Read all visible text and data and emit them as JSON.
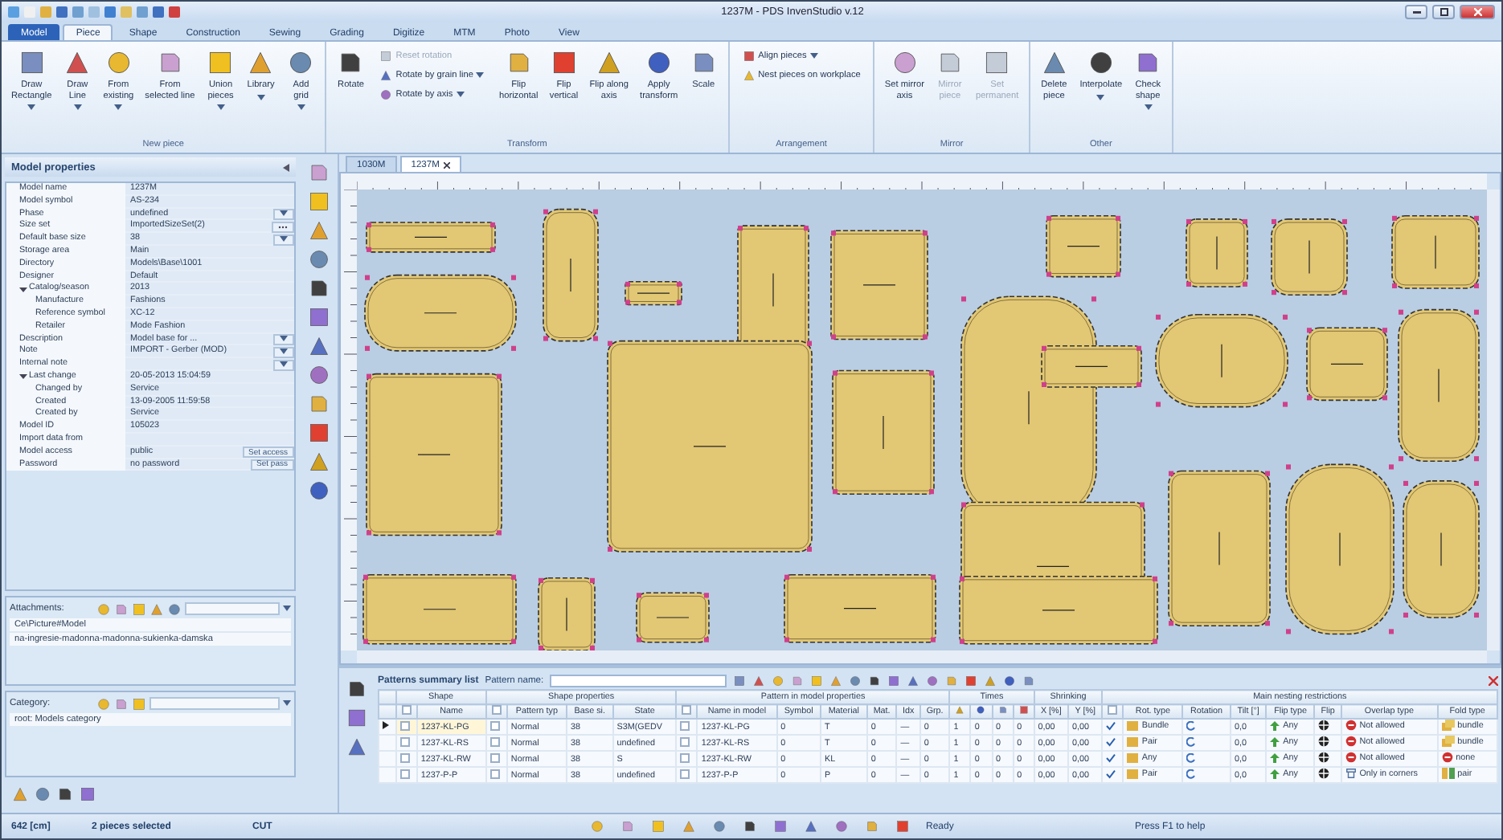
{
  "window": {
    "title": "1237M - PDS InvenStudio v.12"
  },
  "ribbon_tabs": [
    {
      "label": "Model",
      "kind": "app",
      "selected": false
    },
    {
      "label": "Piece",
      "kind": "tab",
      "selected": true
    },
    {
      "label": "Shape",
      "kind": "tab",
      "selected": false
    },
    {
      "label": "Construction",
      "kind": "tab",
      "selected": false
    },
    {
      "label": "Sewing",
      "kind": "tab",
      "selected": false
    },
    {
      "label": "Grading",
      "kind": "tab",
      "selected": false
    },
    {
      "label": "Digitize",
      "kind": "tab",
      "selected": false
    },
    {
      "label": "MTM",
      "kind": "tab",
      "selected": false
    },
    {
      "label": "Photo",
      "kind": "tab",
      "selected": false
    },
    {
      "label": "View",
      "kind": "tab",
      "selected": false
    }
  ],
  "ribbon_groups": [
    {
      "label": "New piece",
      "items": [
        {
          "kind": "large",
          "lines": [
            "Draw",
            "Rectangle"
          ],
          "dropdown": true,
          "disabled": false
        },
        {
          "kind": "large",
          "lines": [
            "Draw",
            "Line"
          ],
          "dropdown": true,
          "disabled": false
        },
        {
          "kind": "large",
          "lines": [
            "From",
            "existing"
          ],
          "dropdown": true,
          "disabled": false
        },
        {
          "kind": "large",
          "lines": [
            "From",
            "selected line"
          ],
          "dropdown": false,
          "disabled": false
        },
        {
          "kind": "large",
          "lines": [
            "Union",
            "pieces"
          ],
          "dropdown": true,
          "disabled": false
        },
        {
          "kind": "large",
          "lines": [
            "Library"
          ],
          "dropdown": true,
          "disabled": false
        },
        {
          "kind": "large",
          "lines": [
            "Add",
            "grid"
          ],
          "dropdown": true,
          "disabled": false
        }
      ]
    },
    {
      "label": "Transform",
      "items": [
        {
          "kind": "large",
          "lines": [
            "Rotate"
          ],
          "dropdown": false,
          "disabled": false
        },
        {
          "kind": "stack",
          "items": [
            {
              "label": "Reset rotation",
              "dropdown": false,
              "disabled": true
            },
            {
              "label": "Rotate by grain line",
              "dropdown": true,
              "disabled": false
            },
            {
              "label": "Rotate by axis",
              "dropdown": true,
              "disabled": false
            }
          ]
        },
        {
          "kind": "large",
          "lines": [
            "Flip",
            "horizontal"
          ],
          "dropdown": false,
          "disabled": false
        },
        {
          "kind": "large",
          "lines": [
            "Flip",
            "vertical"
          ],
          "dropdown": false,
          "disabled": false
        },
        {
          "kind": "large",
          "lines": [
            "Flip along",
            "axis"
          ],
          "dropdown": false,
          "disabled": false
        },
        {
          "kind": "large",
          "lines": [
            "Apply",
            "transform"
          ],
          "dropdown": false,
          "disabled": false
        },
        {
          "kind": "large",
          "lines": [
            "Scale"
          ],
          "dropdown": false,
          "disabled": false
        }
      ]
    },
    {
      "label": "Arrangement",
      "items": [
        {
          "kind": "stack",
          "items": [
            {
              "label": "Align pieces",
              "dropdown": true,
              "disabled": false
            },
            {
              "label": "Nest pieces on workplace",
              "dropdown": false,
              "disabled": false
            }
          ]
        }
      ]
    },
    {
      "label": "Mirror",
      "items": [
        {
          "kind": "large",
          "lines": [
            "Set mirror",
            "axis"
          ],
          "dropdown": false,
          "disabled": false
        },
        {
          "kind": "large",
          "lines": [
            "Mirror",
            "piece"
          ],
          "dropdown": false,
          "disabled": true
        },
        {
          "kind": "large",
          "lines": [
            "Set",
            "permanent"
          ],
          "dropdown": false,
          "disabled": true
        }
      ]
    },
    {
      "label": "Other",
      "items": [
        {
          "kind": "large",
          "lines": [
            "Delete",
            "piece"
          ],
          "dropdown": false,
          "disabled": false
        },
        {
          "kind": "large",
          "lines": [
            "Interpolate"
          ],
          "dropdown": true,
          "disabled": false
        },
        {
          "kind": "large",
          "lines": [
            "Check",
            "shape"
          ],
          "dropdown": true,
          "disabled": false
        }
      ]
    }
  ],
  "model_properties": {
    "title": "Model properties",
    "rows": [
      {
        "name": "Model name",
        "value": "1237M"
      },
      {
        "name": "Model symbol",
        "value": "AS-234"
      },
      {
        "kind": "dropdown",
        "name": "Phase",
        "value": "undefined"
      },
      {
        "kind": "ellipsis",
        "name": "Size set",
        "value": "ImportedSizeSet(2)"
      },
      {
        "kind": "dropdown",
        "name": "Default base size",
        "value": "38"
      },
      {
        "name": "Storage area",
        "value": "Main"
      },
      {
        "name": "Directory",
        "value": "Models\\Base\\1001"
      },
      {
        "name": "Designer",
        "value": "Default"
      },
      {
        "name": "Catalog/season",
        "value": "2013",
        "expanded": true,
        "children": [
          {
            "name": "Manufacture",
            "value": "Fashions"
          },
          {
            "name": "Reference symbol",
            "value": "XC-12"
          },
          {
            "name": "Retailer",
            "value": "Mode Fashion"
          }
        ]
      },
      {
        "kind": "dropdown",
        "name": "Description",
        "value": "Model base for ..."
      },
      {
        "kind": "dropdown",
        "name": "Note",
        "value": "IMPORT - Gerber (MOD)"
      },
      {
        "kind": "dropdown",
        "name": "Internal note"
      },
      {
        "name": "Last change",
        "value": "20-05-2013 15:04:59",
        "expanded": true,
        "children": [
          {
            "name": "Changed by",
            "value": "Service"
          },
          {
            "name": "Created",
            "value": "13-09-2005 11:59:58"
          },
          {
            "name": "Created by",
            "value": "Service"
          }
        ]
      },
      {
        "name": "Model ID",
        "value": "105023"
      },
      {
        "name": "Import data from"
      },
      {
        "kind": "button",
        "name": "Model access",
        "value": "public",
        "button": "Set access"
      },
      {
        "kind": "button",
        "name": "Password",
        "value": "no password",
        "button": "Set pass"
      }
    ]
  },
  "attachments": {
    "label": "Attachments:",
    "items": [
      "Ce\\Picture#Model",
      "na-ingresie-madonna-madonna-sukienka-damska"
    ]
  },
  "category": {
    "label": "Category:",
    "items": [
      "root: Models category"
    ]
  },
  "documents": [
    {
      "label": "1030M",
      "selected": false
    },
    {
      "label": "1237M",
      "selected": true
    }
  ],
  "summary": {
    "title": "Patterns summary list",
    "filter_label": "Pattern name:",
    "groups": [
      {
        "label": "Shape",
        "columns": [
          {
            "kind": "check"
          },
          {
            "kind": "text",
            "label": "Name"
          }
        ]
      },
      {
        "label": "Shape properties",
        "columns": [
          {
            "kind": "check"
          },
          {
            "kind": "text",
            "label": "Pattern typ"
          },
          {
            "kind": "text",
            "label": "Base si."
          },
          {
            "kind": "text",
            "label": "State"
          }
        ]
      },
      {
        "label": "Pattern in model properties",
        "columns": [
          {
            "kind": "check"
          },
          {
            "kind": "text",
            "label": "Name in model"
          },
          {
            "kind": "text",
            "label": "Symbol"
          },
          {
            "kind": "text",
            "label": "Material"
          },
          {
            "kind": "text",
            "label": "Mat."
          },
          {
            "kind": "text",
            "label": "Idx"
          },
          {
            "kind": "text",
            "label": "Grp."
          }
        ]
      },
      {
        "label": "Times",
        "columns": [
          {
            "kind": "time"
          },
          {
            "kind": "time"
          },
          {
            "kind": "time"
          },
          {
            "kind": "time"
          }
        ]
      },
      {
        "label": "Shrinking",
        "columns": [
          {
            "kind": "text",
            "label": "X [%]"
          },
          {
            "kind": "text",
            "label": "Y [%]"
          }
        ]
      },
      {
        "label": "Main nesting restrictions",
        "columns": [
          {
            "kind": "tick"
          },
          {
            "kind": "icontext",
            "label": "Rot. type"
          },
          {
            "kind": "rotation",
            "label": "Rotation"
          },
          {
            "kind": "text",
            "label": "Tilt [°]"
          },
          {
            "kind": "fliptext",
            "label": "Flip type"
          },
          {
            "kind": "flip",
            "label": "Flip"
          },
          {
            "kind": "overlap",
            "label": "Overlap type"
          },
          {
            "kind": "fold",
            "label": "Fold type"
          }
        ]
      }
    ],
    "rows": [
      {
        "selected": true,
        "cells": [
          false,
          "1237-KL-PG",
          false,
          "Normal",
          "38",
          "S3M(GEDV",
          false,
          "1237-KL-PG",
          "0",
          "T",
          "0",
          "—",
          "0",
          "1",
          "0",
          "0",
          "0",
          "0,00",
          "0,00",
          true,
          "Bundle",
          "0,0",
          "Any",
          {
            "kind": "forbidden",
            "text": "Not allowed"
          },
          {
            "kind": "bundle",
            "text": "bundle"
          }
        ]
      },
      {
        "selected": false,
        "cells": [
          false,
          "1237-KL-RS",
          false,
          "Normal",
          "38",
          "undefined",
          false,
          "1237-KL-RS",
          "0",
          "T",
          "0",
          "—",
          "0",
          "1",
          "0",
          "0",
          "0",
          "0,00",
          "0,00",
          true,
          "Pair",
          "0,0",
          "Any",
          {
            "kind": "forbidden",
            "text": "Not allowed"
          },
          {
            "kind": "bundle",
            "text": "bundle"
          }
        ]
      },
      {
        "selected": false,
        "cells": [
          false,
          "1237-KL-RW",
          false,
          "Normal",
          "38",
          "S",
          false,
          "1237-KL-RW",
          "0",
          "KL",
          "0",
          "—",
          "0",
          "1",
          "0",
          "0",
          "0",
          "0,00",
          "0,00",
          true,
          "Any",
          "0,0",
          "Any",
          {
            "kind": "forbidden",
            "text": "Not allowed"
          },
          {
            "kind": "none",
            "text": "none"
          }
        ]
      },
      {
        "selected": false,
        "cells": [
          false,
          "1237-P-P",
          false,
          "Normal",
          "38",
          "undefined",
          false,
          "1237-P-P",
          "0",
          "P",
          "0",
          "—",
          "0",
          "1",
          "0",
          "0",
          "0",
          "0,00",
          "0,00",
          true,
          "Pair",
          "0,0",
          "Any",
          {
            "kind": "corners",
            "text": "Only in corners"
          },
          {
            "kind": "pair",
            "text": "pair"
          }
        ]
      }
    ]
  },
  "status_bar": {
    "length": "642 [cm]",
    "selection": "2 pieces selected",
    "mode": "CUT",
    "state": "Ready",
    "hint": "Press F1 to help"
  }
}
